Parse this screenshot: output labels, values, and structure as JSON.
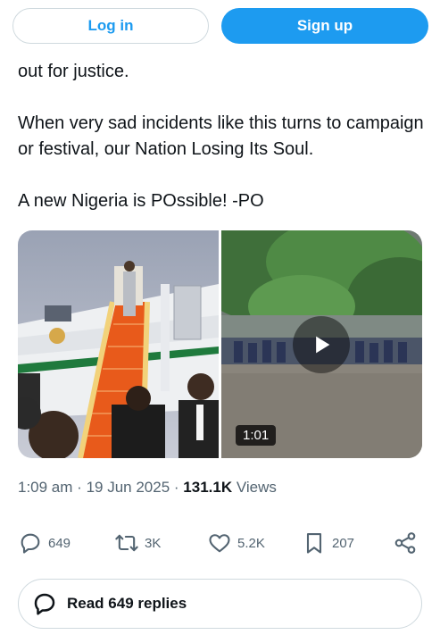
{
  "header": {
    "login_label": "Log in",
    "signup_label": "Sign up"
  },
  "tweet": {
    "paragraphs": [
      "out for justice.",
      "When very sad incidents like this turns to campaign or festival, our Nation Losing Its Soul.",
      "A new Nigeria is POssible! -PO"
    ],
    "video_duration": "1:01",
    "time": "1:09 am",
    "date": "19 Jun 2025",
    "views_count": "131.1K",
    "views_label": "Views"
  },
  "actions": {
    "replies": "649",
    "reposts": "3K",
    "likes": "5.2K",
    "bookmarks": "207"
  },
  "read_replies_label": "Read 649 replies",
  "icons": {
    "reply": "reply-bubble-icon",
    "repost": "repost-arrows-icon",
    "like": "heart-icon",
    "bookmark": "bookmark-icon",
    "share": "share-icon",
    "play": "play-icon"
  },
  "colors": {
    "brand_blue": "#1d9bf0",
    "text_primary": "#0f1419",
    "text_secondary": "#536471",
    "border": "#cfd9de"
  }
}
